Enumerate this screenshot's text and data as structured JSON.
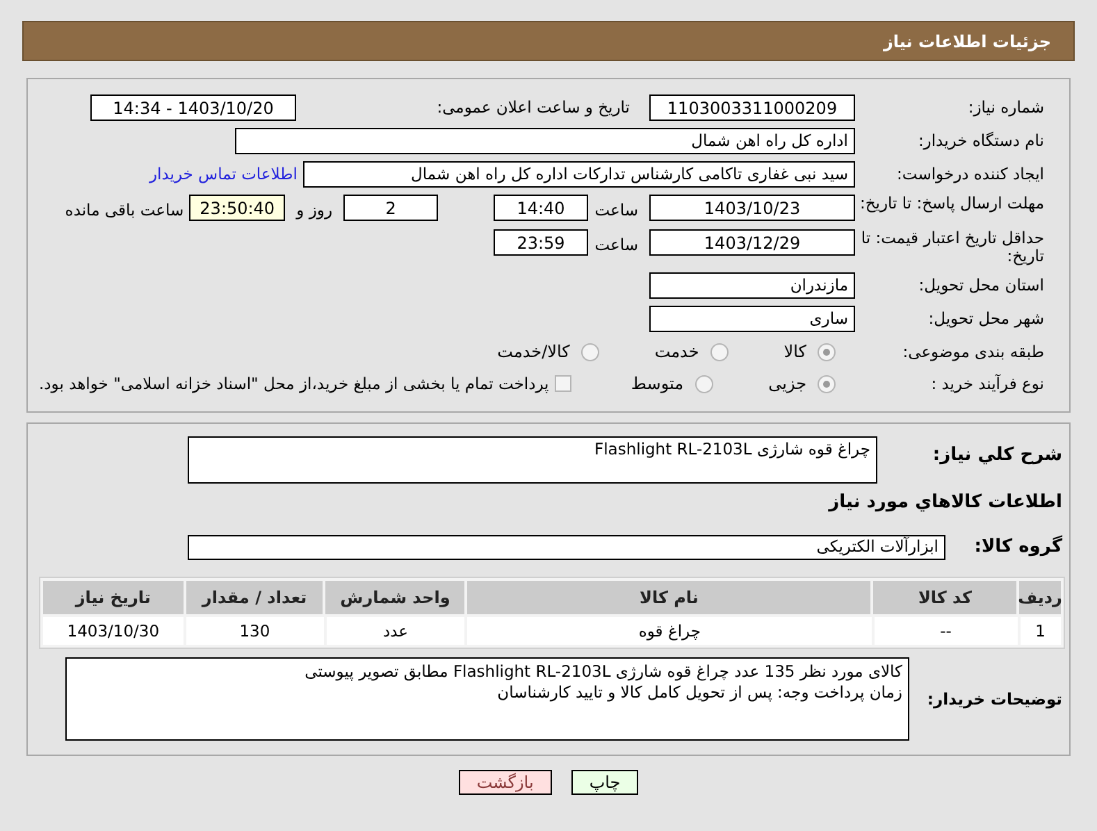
{
  "header": {
    "title": "جزئیات اطلاعات نیاز"
  },
  "info": {
    "need_number": {
      "label": "شماره نیاز:",
      "value": "1103003311000209"
    },
    "announce": {
      "label": "تاریخ و ساعت اعلان عمومی:",
      "value": "1403/10/20 - 14:34"
    },
    "buyer": {
      "label": "نام دستگاه خریدار:",
      "value": "اداره کل راه اهن شمال"
    },
    "requester": {
      "label": "ایجاد کننده درخواست:",
      "value": "سید نبی غفاری تاکامی کارشناس تدارکات اداره کل راه اهن شمال",
      "link": "اطلاعات تماس خریدار"
    },
    "deadline": {
      "label": "مهلت ارسال پاسخ: تا تاریخ:",
      "date": "1403/10/23",
      "time_label": "ساعت",
      "time": "14:40",
      "days": "2",
      "days_label": "روز و",
      "remaining": "23:50:40",
      "remaining_label": "ساعت باقی مانده"
    },
    "validity": {
      "label": "حداقل تاریخ اعتبار قیمت: تا تاریخ:",
      "date": "1403/12/29",
      "time_label": "ساعت",
      "time": "23:59"
    },
    "province": {
      "label": "استان محل تحویل:",
      "value": "مازندران"
    },
    "city": {
      "label": "شهر محل تحویل:",
      "value": "ساری"
    },
    "category": {
      "label": "طبقه بندی موضوعی:",
      "options": [
        {
          "label": "کالا",
          "selected": true
        },
        {
          "label": "خدمت",
          "selected": false
        },
        {
          "label": "کالا/خدمت",
          "selected": false
        }
      ]
    },
    "process": {
      "label": "نوع فرآیند خرید :",
      "options": [
        {
          "label": "جزیی",
          "selected": true
        },
        {
          "label": "متوسط",
          "selected": false
        }
      ],
      "treasury": {
        "checked": false,
        "text": "پرداخت تمام یا بخشی از مبلغ خرید،از محل \"اسناد خزانه اسلامی\" خواهد بود."
      }
    }
  },
  "details": {
    "summary_label": "شرح کلي نياز:",
    "summary": "چراغ قوه شارژی Flashlight RL-2103L",
    "items_heading": "اطلاعات کالاهاي مورد نياز",
    "group_label": "گروه کالا:",
    "group": "ابزارآلات الکتریکی",
    "table": {
      "columns": [
        "ردیف",
        "کد کالا",
        "نام کالا",
        "واحد شمارش",
        "تعداد / مقدار",
        "تاریخ نیاز"
      ],
      "rows": [
        [
          "1",
          "--",
          "چراغ قوه",
          "عدد",
          "130",
          "1403/10/30"
        ]
      ]
    },
    "notes_label": "توضیحات خریدار:",
    "notes": [
      "کالای مورد نظر 135 عدد چراغ قوه شارژی Flashlight RL-2103L مطابق تصویر پیوستی",
      "زمان پرداخت وجه: پس از تحویل کامل کالا و تایید کارشناسان"
    ]
  },
  "buttons": [
    {
      "kind": "print",
      "label": "چاپ"
    },
    {
      "kind": "back",
      "label": "بازگشت"
    }
  ]
}
